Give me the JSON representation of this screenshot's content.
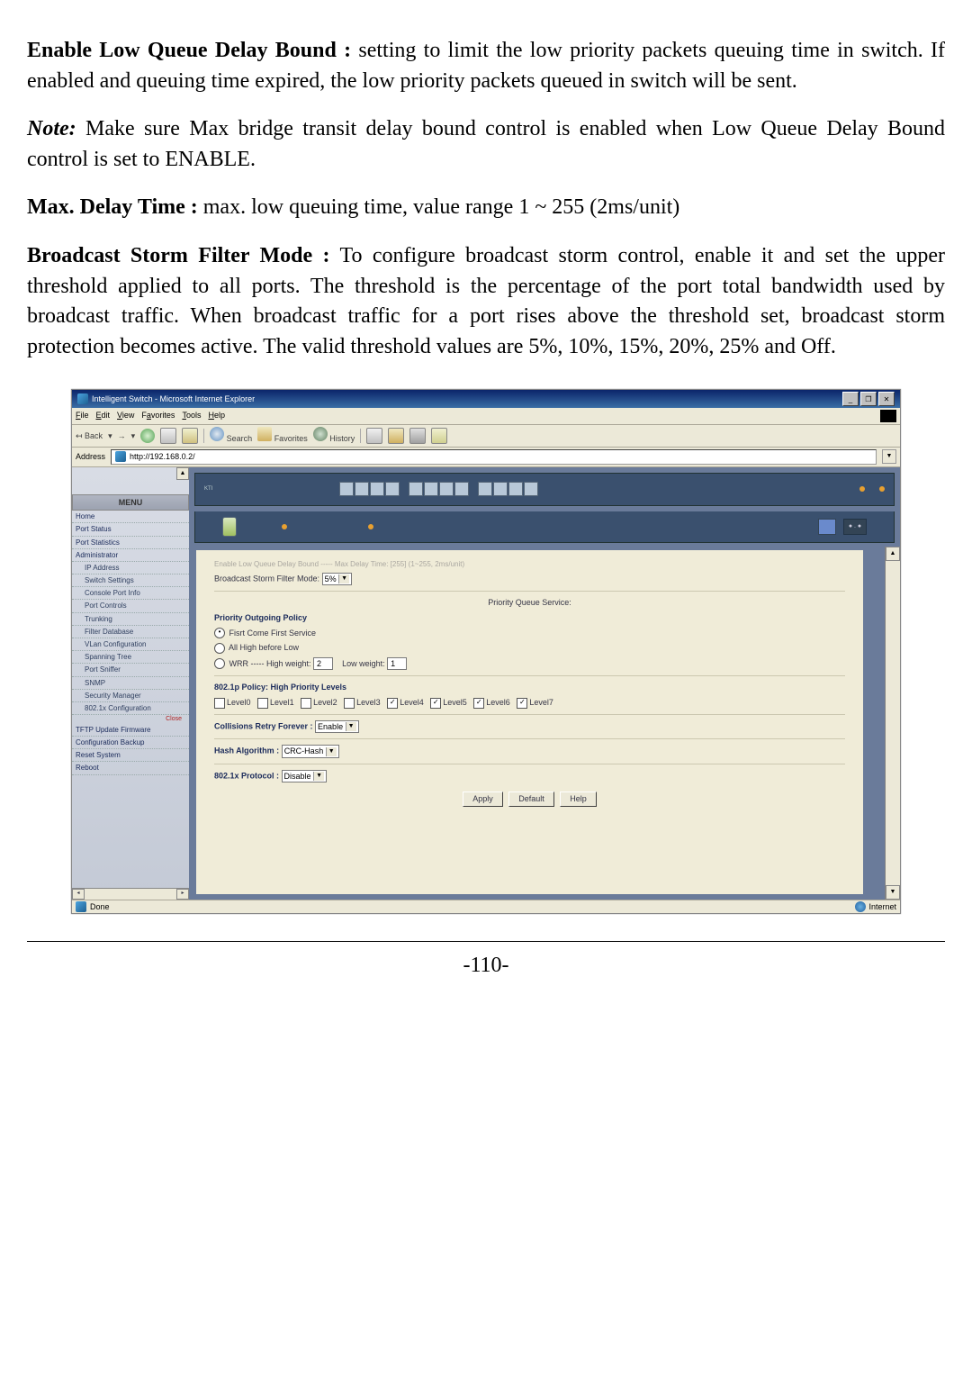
{
  "doc": {
    "p1_label": "Enable Low Queue Delay Bound :",
    "p1_text": " setting to limit the low priority packets queuing time in switch. If enabled and queuing time expired, the low priority packets queued in switch will be sent.",
    "p2_label": "Note:",
    "p2_text": " Make sure Max bridge transit delay bound control is enabled when Low Queue Delay Bound control is set to ENABLE.",
    "p3_label": "Max. Delay Time :",
    "p3_text": " max. low queuing time, value range 1 ~ 255 (2ms/unit)",
    "p4_label": "Broadcast Storm Filter Mode :",
    "p4_text": " To configure broadcast storm control, enable it and set the upper threshold applied to all ports. The threshold is the percentage of the port total bandwidth used by broadcast traffic. When broadcast traffic for a port rises above the threshold set, broadcast storm protection becomes active. The valid threshold values are 5%, 10%, 15%, 20%, 25% and Off.",
    "page_number": "-110-"
  },
  "screenshot": {
    "title": "Intelligent Switch - Microsoft Internet Explorer",
    "menubar": [
      "File",
      "Edit",
      "View",
      "Favorites",
      "Tools",
      "Help"
    ],
    "toolbar": {
      "back": "Back",
      "search": "Search",
      "favorites": "Favorites",
      "history": "History"
    },
    "address_label": "Address",
    "address_value": "http://192.168.0.2/",
    "sidebar": {
      "header": "MENU",
      "items": [
        "Home",
        "Port Status",
        "Port Statistics",
        "Administrator",
        "IP Address",
        "Switch Settings",
        "Console Port Info",
        "Port Controls",
        "Trunking",
        "Filter Database",
        "VLan Configuration",
        "Spanning Tree",
        "Port Sniffer",
        "SNMP",
        "Security Manager",
        "802.1x Configuration",
        "TFTP Update Firmware",
        "Configuration Backup",
        "Reset System",
        "Reboot"
      ],
      "close": "Close"
    },
    "panel": {
      "top_faint": "Enable Low Queue Delay Bound ----- Max Delay Time: [255]    (1~255, 2ms/unit)",
      "bsfm_label": "Broadcast Storm Filter Mode:",
      "bsfm_value": "5%",
      "pqs_label": "Priority Queue Service:",
      "pop_label": "Priority Outgoing Policy",
      "pol_fcfs": "Fisrt Come First Service",
      "pol_allhigh": "All High before Low",
      "pol_wrr": "WRR ----- High weight:",
      "pol_wrr_high": "2",
      "pol_wrr_low_lbl": "Low weight:",
      "pol_wrr_low": "1",
      "policy_8021p": "802.1p Policy: High Priority Levels",
      "levels": [
        "Level0",
        "Level1",
        "Level2",
        "Level3",
        "Level4",
        "Level5",
        "Level6",
        "Level7"
      ],
      "levels_checked": [
        false,
        false,
        false,
        false,
        true,
        true,
        true,
        true
      ],
      "collisions_lbl": "Collisions Retry Forever :",
      "collisions_val": "Enable",
      "hash_lbl": "Hash Algorithm :",
      "hash_val": "CRC-Hash",
      "proto_lbl": "802.1x Protocol :",
      "proto_val": "Disable",
      "btn_apply": "Apply",
      "btn_default": "Default",
      "btn_help": "Help"
    },
    "status_left": "Done",
    "status_right": "Internet"
  }
}
